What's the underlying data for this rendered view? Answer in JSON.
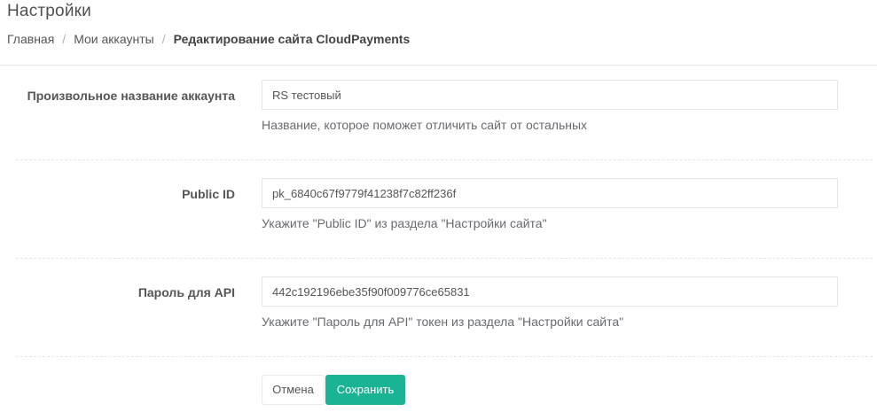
{
  "header": {
    "title": "Настройки"
  },
  "breadcrumb": {
    "items": [
      {
        "label": "Главная"
      },
      {
        "label": "Мои аккаунты"
      }
    ],
    "current": "Редактирование сайта CloudPayments",
    "separator": "/"
  },
  "form": {
    "fields": [
      {
        "label": "Произвольное название аккаунта",
        "value": "RS тестовый",
        "help": "Название, которое поможет отличить сайт от остальных"
      },
      {
        "label": "Public ID",
        "value": "pk_6840c67f9779f41238f7c82ff236f",
        "help": "Укажите \"Public ID\" из раздела \"Настройки сайта\""
      },
      {
        "label": "Пароль для API",
        "value": "442c192196ebe35f90f009776ce65831",
        "help": "Укажите \"Пароль для API\" токен из раздела \"Настройки сайта\""
      }
    ],
    "cancel_label": "Отмена",
    "save_label": "Сохранить"
  },
  "colors": {
    "primary": "#1ab394",
    "text": "#555555",
    "border": "#e5e6e7"
  }
}
